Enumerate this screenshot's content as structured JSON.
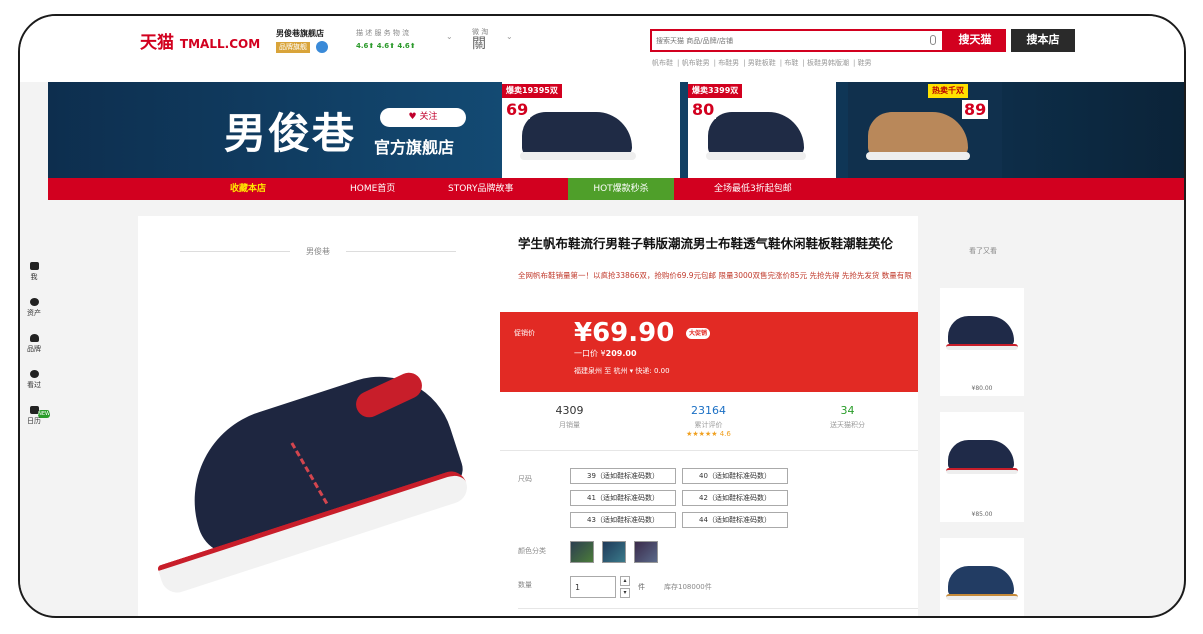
{
  "header": {
    "logo_cn": "天猫",
    "logo_en": "TMALL.COM",
    "shop_name": "男俊巷旗舰店",
    "shop_badge": "品牌旗舰",
    "ratings_labels": "描 述  服 务  物 流",
    "ratings_values": "4.6⬆  4.6⬆  4.6⬆",
    "wechat_label": "微 淘",
    "wechat_icon": "關",
    "search_placeholder": "搜索天猫 商品/品牌/店铺",
    "btn_tmall": "搜天猫",
    "btn_shop": "搜本店",
    "hotwords": [
      "帆布鞋",
      "帆布鞋男",
      "布鞋男",
      "男鞋板鞋",
      "布鞋",
      "板鞋男韩版潮",
      "鞋男"
    ]
  },
  "banner": {
    "brand": "男俊巷",
    "follow": "♥ 关注",
    "sub": "官方旗舰店",
    "promos": [
      {
        "tag": "爆卖19395双",
        "price": "69"
      },
      {
        "tag": "爆卖3399双",
        "price": "80"
      },
      {
        "tag": "热卖千双",
        "price": "89"
      }
    ]
  },
  "nav": [
    "收藏本店",
    "HOME首页",
    "STORY品牌故事",
    "HOT爆款秒杀",
    "全场最低3折起包邮"
  ],
  "rail": [
    "我",
    "资产",
    "品牌",
    "看过",
    "日历"
  ],
  "rail_badge": "NEW",
  "product": {
    "gallery_title": "男俊巷",
    "title": "学生帆布鞋流行男鞋子韩版潮流男士布鞋透气鞋休闲鞋板鞋潮鞋英伦",
    "subtitle": "全网帆布鞋销量第一！以疯抢33866双，抢购价69.9元包邮 限量3000双售完涨价85元 先抢先得 先抢先发货 数量有限",
    "price_label": "促销价",
    "price": "¥69.90",
    "price_badge": "大促销",
    "orig_label": "一口价 ¥",
    "orig_price": "209.00",
    "shipping": "福建泉州 至 杭州 ▾ 快递: 0.00",
    "stats": [
      {
        "num": "4309",
        "label": "月销量"
      },
      {
        "num": "23164",
        "label": "累计评价",
        "stars": "★★★★★ 4.6"
      },
      {
        "num": "34",
        "label": "送天猫积分"
      }
    ],
    "size_label": "尺码",
    "sizes": [
      "39（适如鞋标准码数）",
      "40（适如鞋标准码数）",
      "41（适如鞋标准码数）",
      "42（适如鞋标准码数）",
      "43（适如鞋标准码数）",
      "44（适如鞋标准码数）"
    ],
    "color_label": "颜色分类",
    "qty_label": "数量",
    "qty": "1",
    "qty_unit": "件",
    "stock": "库存108000件"
  },
  "side": {
    "title": "看了又看",
    "items": [
      {
        "price": "¥80.00"
      },
      {
        "price": "¥85.00"
      },
      {
        "price": ""
      }
    ]
  }
}
